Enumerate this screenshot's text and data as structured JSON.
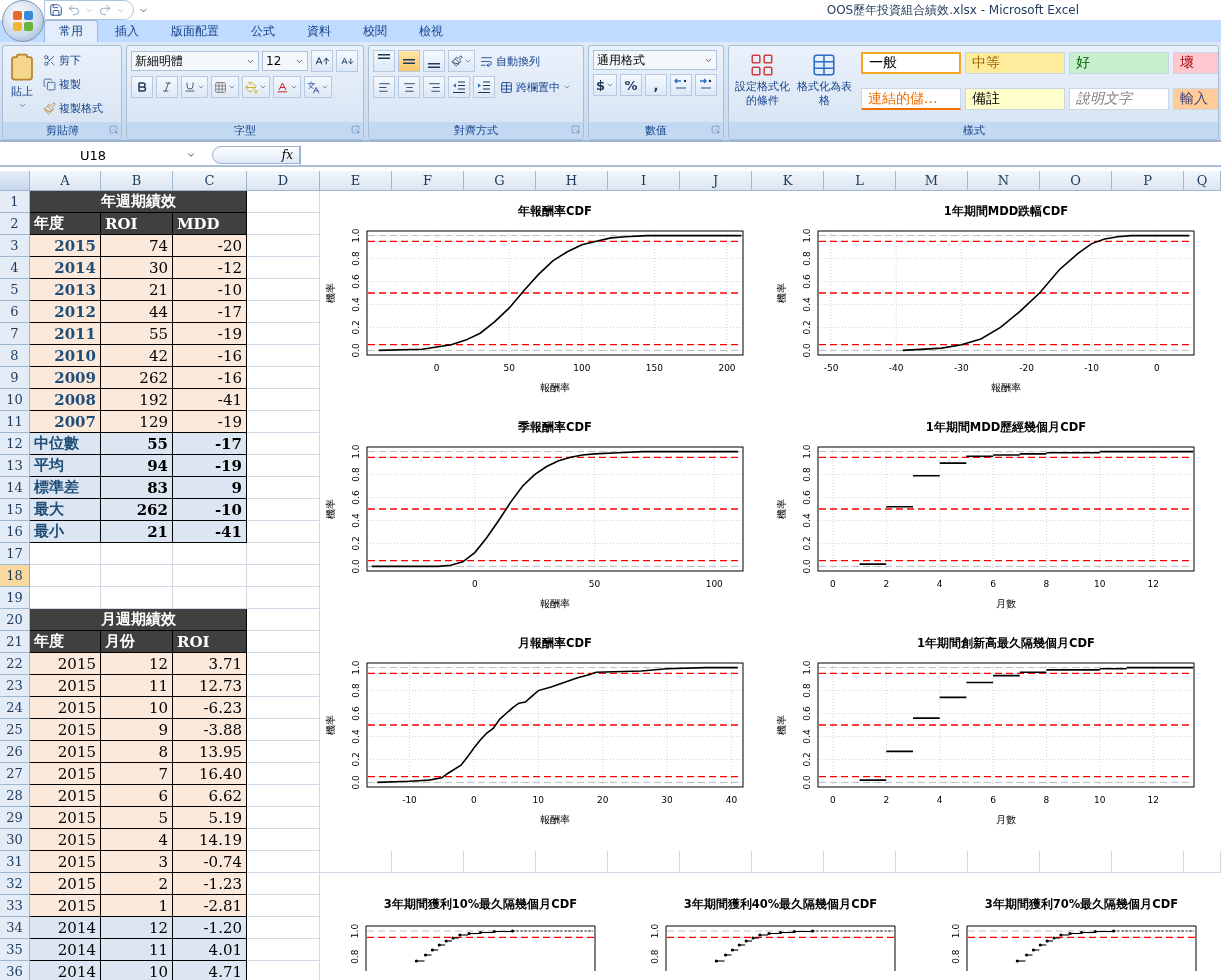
{
  "window": {
    "title": "OOS歷年投資組合績效.xlsx - Microsoft Excel"
  },
  "tabs": [
    {
      "label": "常用",
      "selected": true
    },
    {
      "label": "插入",
      "selected": false
    },
    {
      "label": "版面配置",
      "selected": false
    },
    {
      "label": "公式",
      "selected": false
    },
    {
      "label": "資料",
      "selected": false
    },
    {
      "label": "校閱",
      "selected": false
    },
    {
      "label": "檢視",
      "selected": false
    }
  ],
  "ribbon": {
    "clipboard": {
      "label": "剪貼簿",
      "paste": "貼上",
      "items": [
        {
          "kind": "cut",
          "label": "剪下"
        },
        {
          "kind": "copy",
          "label": "複製"
        },
        {
          "kind": "painter",
          "label": "複製格式"
        }
      ]
    },
    "font": {
      "label": "字型",
      "name": "新細明體",
      "size": "12"
    },
    "alignment": {
      "label": "對齊方式",
      "vertical": [
        {
          "selected": false
        },
        {
          "selected": true
        },
        {
          "selected": false
        }
      ],
      "wrap": "自動換列",
      "merge": "跨欄置中"
    },
    "number": {
      "label": "數值",
      "format": "通用格式",
      "symbols": [
        "$",
        "%",
        ","
      ]
    },
    "styles": {
      "label": "樣式",
      "conditional": "設定格式化的條件",
      "as_table": "格式化為表格",
      "gallery": [
        {
          "label": "一般",
          "kind": "normal",
          "color": "#ffffff",
          "selected": true
        },
        {
          "label": "中等",
          "kind": "neutral",
          "color": "#ffeb9c",
          "selected": false
        },
        {
          "label": "好",
          "kind": "good",
          "color": "#c6efce",
          "selected": false
        },
        {
          "label": "壞",
          "kind": "bad",
          "color": "#ffc7ce",
          "selected": false
        },
        {
          "label": "連結的儲...",
          "kind": "link",
          "color": "#ffffff",
          "selected": false
        },
        {
          "label": "備註",
          "kind": "note",
          "color": "#ffffcc",
          "selected": false
        },
        {
          "label": "說明文字",
          "kind": "explanatory",
          "color": "#ffffff",
          "selected": false
        },
        {
          "label": "輸入",
          "kind": "input",
          "color": "#ffcc99",
          "selected": false
        }
      ]
    }
  },
  "formula_bar": {
    "cell": "U18",
    "fx": "fx"
  },
  "sheet": {
    "columns": [
      "A",
      "B",
      "C",
      "D",
      "E",
      "F",
      "G",
      "H",
      "I",
      "J",
      "K",
      "L",
      "M",
      "N",
      "O",
      "P",
      "Q"
    ],
    "rows": [
      {
        "label": "1",
        "selected": false
      },
      {
        "label": "2",
        "selected": false
      },
      {
        "label": "3",
        "selected": false
      },
      {
        "label": "4",
        "selected": false
      },
      {
        "label": "5",
        "selected": false
      },
      {
        "label": "6",
        "selected": false
      },
      {
        "label": "7",
        "selected": false
      },
      {
        "label": "8",
        "selected": false
      },
      {
        "label": "9",
        "selected": false
      },
      {
        "label": "10",
        "selected": false
      },
      {
        "label": "11",
        "selected": false
      },
      {
        "label": "12",
        "selected": false
      },
      {
        "label": "13",
        "selected": false
      },
      {
        "label": "14",
        "selected": false
      },
      {
        "label": "15",
        "selected": false
      },
      {
        "label": "16",
        "selected": false
      },
      {
        "label": "17",
        "selected": false
      },
      {
        "label": "18",
        "selected": true
      },
      {
        "label": "19",
        "selected": false
      },
      {
        "label": "20",
        "selected": false
      },
      {
        "label": "21",
        "selected": false
      },
      {
        "label": "22",
        "selected": false
      },
      {
        "label": "23",
        "selected": false
      },
      {
        "label": "24",
        "selected": false
      },
      {
        "label": "25",
        "selected": false
      },
      {
        "label": "26",
        "selected": false
      },
      {
        "label": "27",
        "selected": false
      },
      {
        "label": "28",
        "selected": false
      },
      {
        "label": "29",
        "selected": false
      },
      {
        "label": "30",
        "selected": false
      },
      {
        "label": "31",
        "selected": false
      },
      {
        "label": "32",
        "selected": false
      },
      {
        "label": "33",
        "selected": false
      },
      {
        "label": "34",
        "selected": false
      },
      {
        "label": "35",
        "selected": false
      },
      {
        "label": "36",
        "selected": false
      }
    ],
    "tables": [
      {
        "title": "年週期績效",
        "columns": [
          "年度",
          "ROI",
          "MDD"
        ],
        "rows": [
          {
            "kind": "data",
            "cells": [
              "2015",
              "74",
              "-20"
            ]
          },
          {
            "kind": "data",
            "cells": [
              "2014",
              "30",
              "-12"
            ]
          },
          {
            "kind": "data",
            "cells": [
              "2013",
              "21",
              "-10"
            ]
          },
          {
            "kind": "data",
            "cells": [
              "2012",
              "44",
              "-17"
            ]
          },
          {
            "kind": "data",
            "cells": [
              "2011",
              "55",
              "-19"
            ]
          },
          {
            "kind": "data",
            "cells": [
              "2010",
              "42",
              "-16"
            ]
          },
          {
            "kind": "data",
            "cells": [
              "2009",
              "262",
              "-16"
            ]
          },
          {
            "kind": "data",
            "cells": [
              "2008",
              "192",
              "-41"
            ]
          },
          {
            "kind": "data",
            "cells": [
              "2007",
              "129",
              "-19"
            ]
          },
          {
            "kind": "summary",
            "cells": [
              "中位數",
              "55",
              "-17"
            ]
          },
          {
            "kind": "summary",
            "cells": [
              "平均",
              "94",
              "-19"
            ]
          },
          {
            "kind": "summary",
            "cells": [
              "標準差",
              "83",
              "9"
            ]
          },
          {
            "kind": "summary",
            "cells": [
              "最大",
              "262",
              "-10"
            ]
          },
          {
            "kind": "summary",
            "cells": [
              "最小",
              "21",
              "-41"
            ]
          }
        ]
      },
      {
        "title": "月週期績效",
        "columns": [
          "年度",
          "月份",
          "ROI"
        ],
        "rows": [
          {
            "kind": "data",
            "color": "#fbe9db",
            "cells": [
              "2015",
              "12",
              "3.71"
            ]
          },
          {
            "kind": "data",
            "color": "#fbe9db",
            "cells": [
              "2015",
              "11",
              "12.73"
            ]
          },
          {
            "kind": "data",
            "color": "#fbe9db",
            "cells": [
              "2015",
              "10",
              "-6.23"
            ]
          },
          {
            "kind": "data",
            "color": "#fbe9db",
            "cells": [
              "2015",
              "9",
              "-3.88"
            ]
          },
          {
            "kind": "data",
            "color": "#fbe9db",
            "cells": [
              "2015",
              "8",
              "13.95"
            ]
          },
          {
            "kind": "data",
            "color": "#fbe9db",
            "cells": [
              "2015",
              "7",
              "16.40"
            ]
          },
          {
            "kind": "data",
            "color": "#fbe9db",
            "cells": [
              "2015",
              "6",
              "6.62"
            ]
          },
          {
            "kind": "data",
            "color": "#fbe9db",
            "cells": [
              "2015",
              "5",
              "5.19"
            ]
          },
          {
            "kind": "data",
            "color": "#fbe9db",
            "cells": [
              "2015",
              "4",
              "14.19"
            ]
          },
          {
            "kind": "data",
            "color": "#fbe9db",
            "cells": [
              "2015",
              "3",
              "-0.74"
            ]
          },
          {
            "kind": "data",
            "color": "#fbe9db",
            "cells": [
              "2015",
              "2",
              "-1.23"
            ]
          },
          {
            "kind": "data",
            "color": "#fbe9db",
            "cells": [
              "2015",
              "1",
              "-2.81"
            ]
          },
          {
            "kind": "data",
            "color": "#dce6f2",
            "cells": [
              "2014",
              "12",
              "-1.20"
            ]
          },
          {
            "kind": "data",
            "color": "#dce6f2",
            "cells": [
              "2014",
              "11",
              "4.01"
            ]
          },
          {
            "kind": "data",
            "color": "#dce6f2",
            "cells": [
              "2014",
              "10",
              "4.71"
            ]
          }
        ]
      }
    ],
    "chart_panels": [
      {
        "kind": "grid",
        "charts": [
          {
            "chart_data": {
              "type": "line",
              "title": "年報酬率CDF",
              "xlabel": "報酬率",
              "ylabel": "機率",
              "grid": true,
              "xlim": [
                -48,
                211
              ],
              "ylim": [
                -0.04,
                1.04
              ],
              "xticks": [
                0,
                50,
                100,
                150,
                200
              ],
              "yticks": [
                {
                  "value": 0,
                  "label": "0.0"
                },
                {
                  "value": 0.2,
                  "label": "0.2"
                },
                {
                  "value": 0.4,
                  "label": "0.4"
                },
                {
                  "value": 0.6,
                  "label": "0.6"
                },
                {
                  "value": 0.8,
                  "label": "0.8"
                },
                {
                  "value": 1,
                  "label": "1.0"
                }
              ],
              "x": [
                -40,
                -10,
                0,
                10,
                20,
                30,
                40,
                50,
                60,
                70,
                80,
                90,
                100,
                110,
                120,
                130,
                145,
                210
              ],
              "series": [
                {
                  "color": "#000000",
                  "values": [
                    0,
                    0.01,
                    0.03,
                    0.05,
                    0.09,
                    0.15,
                    0.25,
                    0.37,
                    0.52,
                    0.66,
                    0.78,
                    0.86,
                    0.92,
                    0.95,
                    0.98,
                    0.99,
                    1,
                    1
                  ]
                }
              ],
              "ref_lines": [
                {
                  "axis": "y",
                  "value": 0.95,
                  "color": "#ff0000"
                },
                {
                  "axis": "y",
                  "value": 0.5,
                  "color": "#ff0000"
                },
                {
                  "axis": "y",
                  "value": 0.05,
                  "color": "#ff0000"
                }
              ]
            }
          },
          {
            "chart_data": {
              "type": "line",
              "title": "1年期間MDD跌幅CDF",
              "xlabel": "報酬率",
              "ylabel": "機率",
              "grid": true,
              "xlim": [
                -52,
                5.7
              ],
              "ylim": [
                -0.04,
                1.04
              ],
              "xticks": [
                -50,
                -40,
                -30,
                -20,
                -10,
                0
              ],
              "yticks": [
                {
                  "value": 0,
                  "label": "0.0"
                },
                {
                  "value": 0.2,
                  "label": "0.2"
                },
                {
                  "value": 0.4,
                  "label": "0.4"
                },
                {
                  "value": 0.6,
                  "label": "0.6"
                },
                {
                  "value": 0.8,
                  "label": "0.8"
                },
                {
                  "value": 1,
                  "label": "1.0"
                }
              ],
              "x": [
                -39,
                -33,
                -30,
                -27,
                -24,
                -21,
                -18,
                -15,
                -12,
                -10,
                -8,
                -6,
                -4,
                5
              ],
              "series": [
                {
                  "color": "#000000",
                  "values": [
                    0,
                    0.02,
                    0.05,
                    0.1,
                    0.2,
                    0.34,
                    0.5,
                    0.7,
                    0.85,
                    0.93,
                    0.97,
                    0.99,
                    1,
                    1
                  ]
                }
              ],
              "ref_lines": [
                {
                  "axis": "y",
                  "value": 0.95,
                  "color": "#ff0000"
                },
                {
                  "axis": "y",
                  "value": 0.5,
                  "color": "#ff0000"
                },
                {
                  "axis": "y",
                  "value": 0.05,
                  "color": "#ff0000"
                }
              ]
            }
          },
          {
            "chart_data": {
              "type": "line",
              "title": "季報酬率CDF",
              "xlabel": "報酬率",
              "ylabel": "機率",
              "grid": true,
              "xlim": [
                -45,
                112
              ],
              "ylim": [
                -0.04,
                1.04
              ],
              "xticks": [
                0,
                50,
                100
              ],
              "yticks": [
                {
                  "value": 0,
                  "label": "0.0"
                },
                {
                  "value": 0.2,
                  "label": "0.2"
                },
                {
                  "value": 0.4,
                  "label": "0.4"
                },
                {
                  "value": 0.6,
                  "label": "0.6"
                },
                {
                  "value": 0.8,
                  "label": "0.8"
                },
                {
                  "value": 1,
                  "label": "1.0"
                }
              ],
              "x": [
                -43,
                -15,
                -10,
                -5,
                0,
                5,
                10,
                15,
                20,
                25,
                30,
                35,
                40,
                45,
                50,
                60,
                70,
                110
              ],
              "series": [
                {
                  "color": "#000000",
                  "values": [
                    0,
                    0,
                    0.01,
                    0.04,
                    0.12,
                    0.25,
                    0.4,
                    0.56,
                    0.7,
                    0.8,
                    0.87,
                    0.92,
                    0.95,
                    0.97,
                    0.98,
                    0.99,
                    1,
                    1
                  ]
                }
              ],
              "ref_lines": [
                {
                  "axis": "y",
                  "value": 0.95,
                  "color": "#ff0000"
                },
                {
                  "axis": "y",
                  "value": 0.5,
                  "color": "#ff0000"
                },
                {
                  "axis": "y",
                  "value": 0.05,
                  "color": "#ff0000"
                }
              ]
            }
          },
          {
            "chart_data": {
              "type": "line",
              "title": "1年期間MDD歷經幾個月CDF",
              "xlabel": "月數",
              "ylabel": "機率",
              "grid": true,
              "xlim": [
                -0.56,
                13.53
              ],
              "ylim": [
                -0.04,
                1.04
              ],
              "xticks": [
                0,
                2,
                4,
                6,
                8,
                10,
                12
              ],
              "yticks": [
                {
                  "value": 0,
                  "label": "0.0"
                },
                {
                  "value": 0.2,
                  "label": "0.2"
                },
                {
                  "value": 0.4,
                  "label": "0.4"
                },
                {
                  "value": 0.6,
                  "label": "0.6"
                },
                {
                  "value": 0.8,
                  "label": "0.8"
                },
                {
                  "value": 1,
                  "label": "1.0"
                }
              ],
              "x": [
                1,
                2,
                null,
                2,
                3,
                null,
                3,
                4,
                null,
                4,
                5,
                null,
                5,
                6,
                null,
                6,
                7,
                null,
                7,
                8,
                null,
                8,
                9,
                null,
                9,
                10,
                null,
                10,
                13.5
              ],
              "series": [
                {
                  "color": "#000000",
                  "values": [
                    0.02,
                    0.02,
                    null,
                    0.52,
                    0.52,
                    null,
                    0.79,
                    0.79,
                    null,
                    0.9,
                    0.9,
                    null,
                    0.96,
                    0.96,
                    null,
                    0.97,
                    0.97,
                    null,
                    0.98,
                    0.98,
                    null,
                    0.99,
                    0.99,
                    null,
                    0.99,
                    0.99,
                    null,
                    1,
                    1
                  ]
                }
              ],
              "ref_lines": [
                {
                  "axis": "y",
                  "value": 0.95,
                  "color": "#ff0000"
                },
                {
                  "axis": "y",
                  "value": 0.5,
                  "color": "#ff0000"
                },
                {
                  "axis": "y",
                  "value": 0.05,
                  "color": "#ff0000"
                }
              ]
            }
          },
          {
            "chart_data": {
              "type": "line",
              "title": "月報酬率CDF",
              "xlabel": "報酬率",
              "ylabel": "機率",
              "grid": true,
              "xlim": [
                -16.6,
                41.8
              ],
              "ylim": [
                -0.04,
                1.04
              ],
              "xticks": [
                -10,
                0,
                10,
                20,
                30,
                40
              ],
              "yticks": [
                {
                  "value": 0,
                  "label": "0.0"
                },
                {
                  "value": 0.2,
                  "label": "0.2"
                },
                {
                  "value": 0.4,
                  "label": "0.4"
                },
                {
                  "value": 0.6,
                  "label": "0.6"
                },
                {
                  "value": 0.8,
                  "label": "0.8"
                },
                {
                  "value": 1,
                  "label": "1.0"
                }
              ],
              "x": [
                -15,
                -10,
                -7,
                -5,
                -4,
                -2,
                -1,
                0,
                1,
                2,
                3,
                4,
                5,
                6,
                7,
                8,
                9,
                10,
                12,
                14,
                16,
                18,
                19,
                26,
                30,
                36,
                41
              ],
              "series": [
                {
                  "color": "#000000",
                  "values": [
                    0,
                    0.01,
                    0.02,
                    0.04,
                    0.08,
                    0.15,
                    0.22,
                    0.3,
                    0.37,
                    0.43,
                    0.47,
                    0.55,
                    0.6,
                    0.65,
                    0.69,
                    0.7,
                    0.75,
                    0.8,
                    0.83,
                    0.87,
                    0.91,
                    0.94,
                    0.96,
                    0.97,
                    0.99,
                    1,
                    1
                  ]
                }
              ],
              "ref_lines": [
                {
                  "axis": "y",
                  "value": 0.95,
                  "color": "#ff0000"
                },
                {
                  "axis": "y",
                  "value": 0.5,
                  "color": "#ff0000"
                },
                {
                  "axis": "y",
                  "value": 0.05,
                  "color": "#ff0000"
                }
              ]
            }
          },
          {
            "chart_data": {
              "type": "line",
              "title": "1年期間創新高最久隔幾個月CDF",
              "xlabel": "月數",
              "ylabel": "機率",
              "grid": true,
              "xlim": [
                -0.56,
                13.53
              ],
              "ylim": [
                -0.04,
                1.04
              ],
              "xticks": [
                0,
                2,
                4,
                6,
                8,
                10,
                12
              ],
              "yticks": [
                {
                  "value": 0,
                  "label": "0.0"
                },
                {
                  "value": 0.2,
                  "label": "0.2"
                },
                {
                  "value": 0.4,
                  "label": "0.4"
                },
                {
                  "value": 0.6,
                  "label": "0.6"
                },
                {
                  "value": 0.8,
                  "label": "0.8"
                },
                {
                  "value": 1,
                  "label": "1.0"
                }
              ],
              "x": [
                1,
                2,
                null,
                2,
                3,
                null,
                3,
                4,
                null,
                4,
                5,
                null,
                5,
                6,
                null,
                6,
                7,
                null,
                7,
                8,
                null,
                8,
                10,
                null,
                10,
                11,
                null,
                11,
                13.5
              ],
              "series": [
                {
                  "color": "#000000",
                  "values": [
                    0.02,
                    0.02,
                    null,
                    0.27,
                    0.27,
                    null,
                    0.56,
                    0.56,
                    null,
                    0.74,
                    0.74,
                    null,
                    0.87,
                    0.87,
                    null,
                    0.93,
                    0.93,
                    null,
                    0.96,
                    0.96,
                    null,
                    0.98,
                    0.98,
                    null,
                    0.99,
                    0.99,
                    null,
                    1,
                    1
                  ]
                }
              ],
              "ref_lines": [
                {
                  "axis": "y",
                  "value": 0.95,
                  "color": "#ff0000"
                },
                {
                  "axis": "y",
                  "value": 0.5,
                  "color": "#ff0000"
                },
                {
                  "axis": "y",
                  "value": 0.05,
                  "color": "#ff0000"
                }
              ]
            }
          }
        ]
      },
      {
        "kind": "row",
        "charts": [
          {
            "kind": "picture",
            "title": "3年期間獲利10%最久隔幾個月CDF",
            "tick_labels": [
              "1.0",
              "0.8"
            ]
          },
          {
            "kind": "picture",
            "title": "3年期間獲利40%最久隔幾個月CDF",
            "tick_labels": [
              "1.0",
              "0.8"
            ]
          },
          {
            "kind": "picture",
            "title": "3年期間獲利70%最久隔幾個月CDF",
            "tick_labels": [
              "1.0",
              "0.8"
            ]
          }
        ]
      }
    ]
  }
}
